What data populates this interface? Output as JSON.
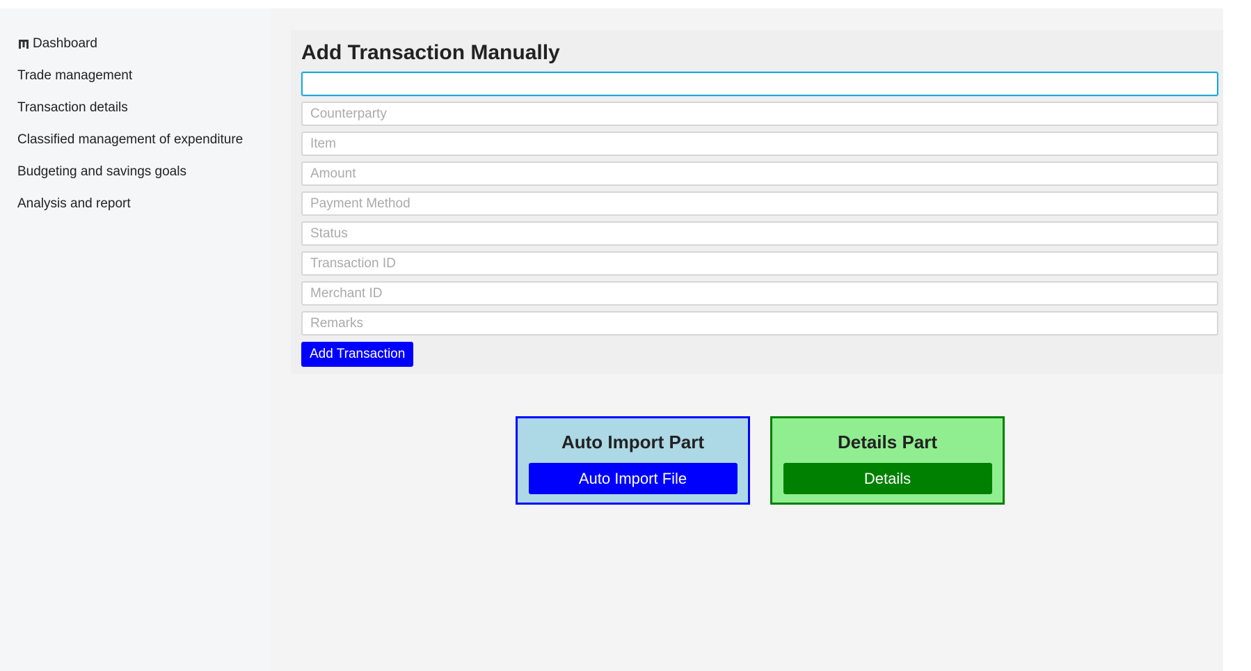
{
  "sidebar": {
    "items": [
      {
        "label": "Dashboard",
        "icon": "dashboard-icon"
      },
      {
        "label": "Trade management"
      },
      {
        "label": "Transaction details"
      },
      {
        "label": "Classified management of expenditure"
      },
      {
        "label": "Budgeting and savings goals"
      },
      {
        "label": "Analysis and report"
      }
    ]
  },
  "form": {
    "title": "Add Transaction Manually",
    "fields": [
      {
        "placeholder": "",
        "value": ""
      },
      {
        "placeholder": "Counterparty",
        "value": ""
      },
      {
        "placeholder": "Item",
        "value": ""
      },
      {
        "placeholder": "Amount",
        "value": ""
      },
      {
        "placeholder": "Payment Method",
        "value": ""
      },
      {
        "placeholder": "Status",
        "value": ""
      },
      {
        "placeholder": "Transaction ID",
        "value": ""
      },
      {
        "placeholder": "Merchant ID",
        "value": ""
      },
      {
        "placeholder": "Remarks",
        "value": ""
      }
    ],
    "submit_label": "Add Transaction"
  },
  "cards": {
    "auto_import": {
      "title": "Auto Import Part",
      "button_label": "Auto Import File"
    },
    "details": {
      "title": "Details Part",
      "button_label": "Details"
    }
  },
  "colors": {
    "primary_button": "#0000ff",
    "details_button": "#008000",
    "auto_card_bg": "#add8e6",
    "details_card_bg": "#90ee90",
    "focus_border": "#22a6d8"
  }
}
